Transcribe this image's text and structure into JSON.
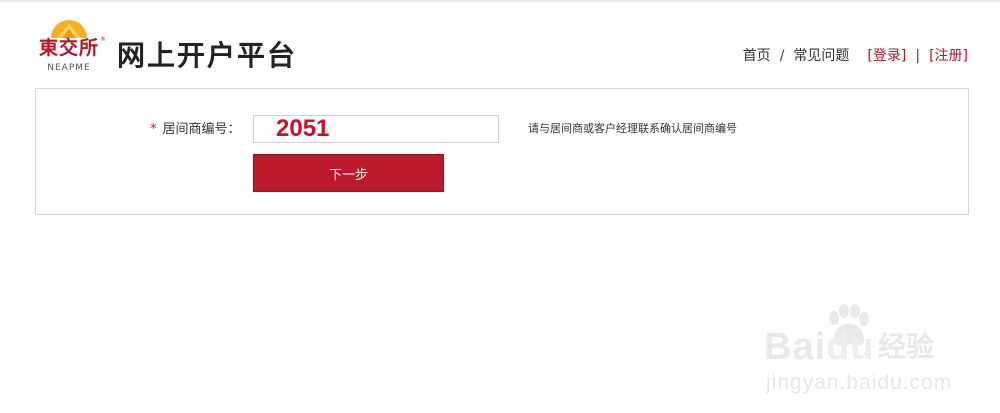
{
  "header": {
    "logo": {
      "cn": "東交所",
      "reg_mark": "®",
      "en": "NEAPME"
    },
    "title": "网上开户平台",
    "nav": {
      "home": "首页",
      "separator": "/",
      "faq": "常见问题",
      "login": "[登录]",
      "pipe": "|",
      "register": "[注册]"
    }
  },
  "form": {
    "required_mark": "*",
    "broker_id_label": "居间商编号：",
    "broker_id_value": "2051",
    "hint": "请与居间商或客户经理联系确认居间商编号",
    "next_button": "下一步"
  },
  "watermark": {
    "brand": "Bai",
    "brand_du": "du",
    "product": "经验",
    "url": "jingyan.baidu.com"
  },
  "colors": {
    "accent_red": "#bc1a2a",
    "link_red": "#a31d2e",
    "logo_gold": "#f2b21c"
  }
}
